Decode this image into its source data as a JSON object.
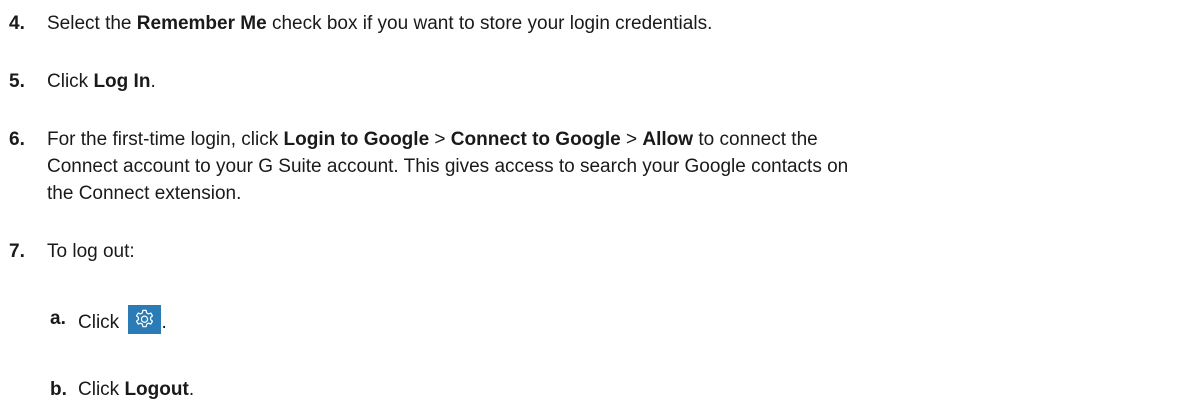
{
  "steps": [
    {
      "number": "4.",
      "parts": [
        "Select the ",
        "Remember Me",
        " check box if you want to store your login credentials."
      ]
    },
    {
      "number": "5.",
      "parts": [
        "Click ",
        "Log In",
        "."
      ]
    },
    {
      "number": "6.",
      "parts": [
        "For the first-time login, click ",
        "Login to Google",
        " > ",
        "Connect to Google",
        " > ",
        "Allow",
        " to connect the"
      ],
      "line2": "Connect account to your G Suite account. This gives access to search your Google contacts on",
      "line3": "the Connect extension."
    },
    {
      "number": "7.",
      "text": "To log out:"
    }
  ],
  "substeps": [
    {
      "letter": "a.",
      "before": "Click",
      "icon": "gear-icon",
      "after": "."
    },
    {
      "letter": "b.",
      "before": "Click ",
      "bold": "Logout",
      "after": "."
    }
  ],
  "colors": {
    "icon_background": "#2b7bb6",
    "icon_stroke": "#ffffff"
  }
}
